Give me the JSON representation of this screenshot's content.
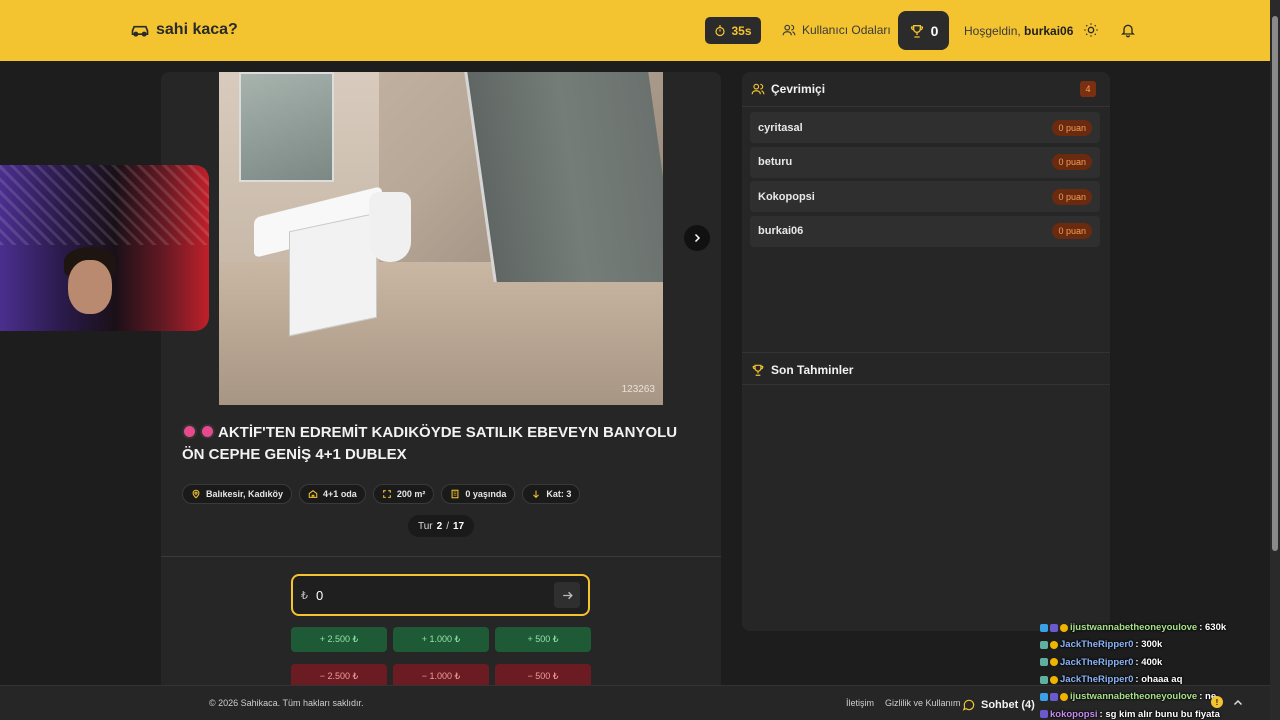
{
  "header": {
    "logo_text": "sahi kaca?",
    "timer": "35s",
    "rooms_label": "Kullanıcı Odaları",
    "score": "0",
    "welcome_prefix": "Hoşgeldin,",
    "username": "burkai06"
  },
  "listing": {
    "image_watermark": "123263",
    "title": "AKTİF'TEN EDREMİT KADIKÖYDE SATILIK EBEVEYN BANYOLU ÖN CEPHE GENİŞ 4+1 DUBLEX",
    "chips": [
      {
        "icon": "map-pin-icon",
        "label": "Balıkesir, Kadıköy"
      },
      {
        "icon": "home-icon",
        "label": "4+1 oda"
      },
      {
        "icon": "area-icon",
        "label": "200 m²"
      },
      {
        "icon": "building-icon",
        "label": "0 yaşında"
      },
      {
        "icon": "arrow-down-icon",
        "label": "Kat: 3"
      }
    ],
    "round_label": "Tur",
    "round_current": "2",
    "round_sep": "/",
    "round_total": "17"
  },
  "guess": {
    "currency": "₺",
    "value": "0",
    "plus_buttons": [
      "+ 2.500 ₺",
      "+ 1.000 ₺",
      "+ 500 ₺"
    ],
    "minus_buttons": [
      "− 2.500 ₺",
      "− 1.000 ₺",
      "− 500 ₺"
    ]
  },
  "online": {
    "title": "Çevrimiçi",
    "count": "4",
    "users": [
      {
        "name": "cyritasal",
        "points": "0 puan"
      },
      {
        "name": "beturu",
        "points": "0 puan"
      },
      {
        "name": "Kokopopsi",
        "points": "0 puan"
      },
      {
        "name": "burkai06",
        "points": "0 puan"
      }
    ]
  },
  "recent": {
    "title": "Son Tahminler"
  },
  "footer": {
    "copyright": "© 2026 Sahikaca. Tüm hakları saklıdır.",
    "contact": "İletişim",
    "privacy": "Gizlilik ve Kullanım",
    "chat_label": "Sohbet (4)"
  },
  "stream_chat": [
    {
      "user": "ijustwannabetheoneyoulove",
      "color": "#a8e08a",
      "msg": ": 630k"
    },
    {
      "user": "JackTheRipper0",
      "color": "#8ab4f8",
      "msg": ": 300k"
    },
    {
      "user": "JackTheRipper0",
      "color": "#8ab4f8",
      "msg": ": 400k"
    },
    {
      "user": "JackTheRipper0",
      "color": "#8ab4f8",
      "msg": ": ohaaa aq"
    },
    {
      "user": "ijustwannabetheoneyoulove",
      "color": "#a8e08a",
      "msg": ": ne"
    },
    {
      "user": "kokopopsi",
      "color": "#c48cf0",
      "msg": ": sg kim alır bunu bu fiyata"
    }
  ],
  "colors": {
    "accent": "#f4c430",
    "panel": "#262626",
    "background": "#1d1d1d",
    "plus": "#1e5a36",
    "minus": "#6b1c22"
  }
}
